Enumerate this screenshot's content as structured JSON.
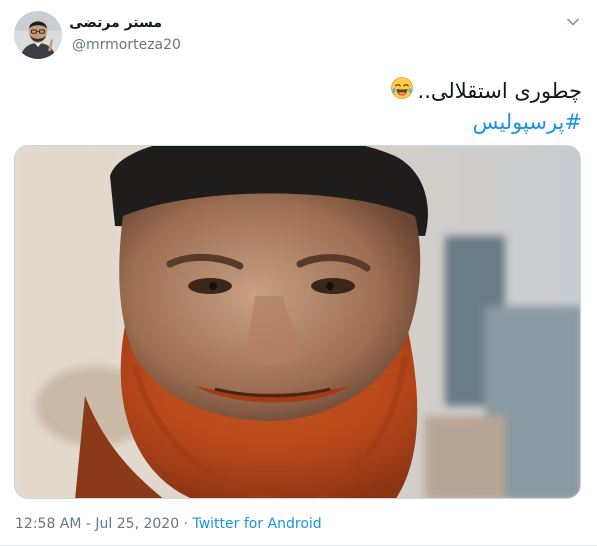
{
  "author": {
    "display_name": "مستر مرتضی",
    "handle": "@mrmorteza20"
  },
  "tweet": {
    "text": "چطوری استقلالی..",
    "emoji_icon": "face-with-tears-of-joy-icon",
    "hashtag": "#پرسپولیس"
  },
  "media": {
    "icon": "photo-bearded-man"
  },
  "meta": {
    "time": "12:58 AM",
    "date": "Jul 25, 2020",
    "separator": "·",
    "source": "Twitter for Android"
  },
  "colors": {
    "link": "#1b95e0",
    "secondary_text": "#657786",
    "primary_text": "#14171a",
    "border": "#ccd6dd"
  }
}
